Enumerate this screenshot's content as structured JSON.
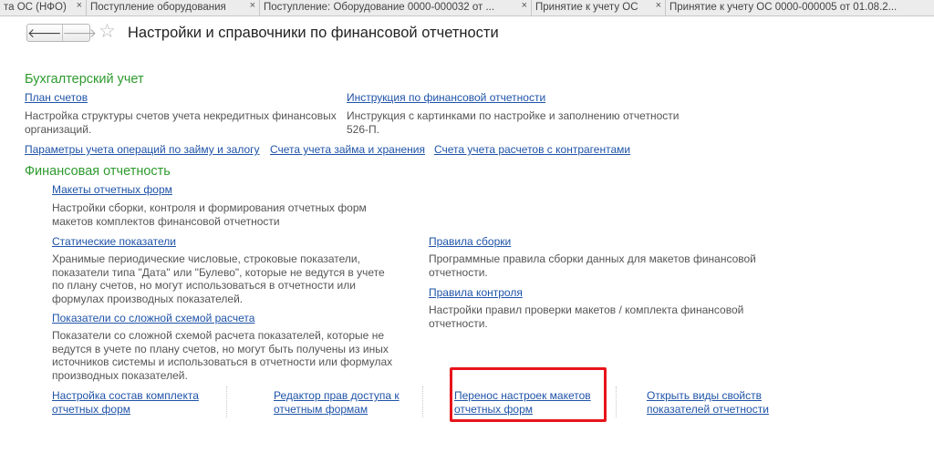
{
  "tabs": [
    {
      "label": "та ОС (НФО)"
    },
    {
      "label": "Поступление оборудования"
    },
    {
      "label": "Поступление: Оборудование 0000-000032 от ..."
    },
    {
      "label": "Принятие к учету ОС"
    },
    {
      "label": "Принятие к учету ОС 0000-000005 от 01.08.2..."
    }
  ],
  "header": {
    "back_icon": "arrow-left-icon",
    "forward_icon": "arrow-right-icon",
    "star_icon": "star-icon",
    "title": "Настройки и справочники по финансовой отчетности"
  },
  "accounting": {
    "heading": "Бухгалтерский учет",
    "chart_of_accounts": {
      "label": "План счетов",
      "desc_line1": "Настройка структуры счетов учета некредитных финансовых",
      "desc_line2": "организаций."
    },
    "instruction": {
      "label": "Инструкция по финансовой отчетности",
      "desc_line1": "Инструкция с картинками по настройке и заполнению отчетности",
      "desc_line2": "526-П."
    },
    "loan_params": "Параметры учета операций по займу и залогу",
    "loan_accounts": "Счета учета займа и хранения",
    "counterparty_accounts": "Счета учета расчетов с контрагентами"
  },
  "reporting": {
    "heading": "Финансовая отчетность",
    "templates": {
      "label": "Макеты отчетных форм",
      "desc_line1": "Настройки сборки, контроля и формирования отчетных форм",
      "desc_line2": "макетов комплектов финансовой отчетности"
    },
    "static_indicators": {
      "label": "Статические показатели",
      "desc_line1": "Хранимые периодические числовые, строковые показатели,",
      "desc_line2": "показатели типа \"Дата\" или \"Булево\", которые не ведутся в учете",
      "desc_line3": "по плану счетов, но могут использоваться в отчетности или",
      "desc_line4": "формулах производных показателей."
    },
    "assembly_rules": {
      "label": "Правила сборки",
      "desc_line1": "Программные правила сборки данных для макетов финансовой",
      "desc_line2": "отчетности."
    },
    "control_rules": {
      "label": "Правила контроля",
      "desc_line1": "Настройки правил проверки макетов / комплекта финансовой",
      "desc_line2": "отчетности."
    },
    "complex_indicators": {
      "label": "Показатели со сложной схемой расчета",
      "desc_line1": "Показатели со сложной схемой расчета показателей, которые не",
      "desc_line2": "ведутся в учете по плану счетов, но могут быть получены из иных",
      "desc_line3": "источников системы и использоваться в отчетности или формулах",
      "desc_line4": "производных показателей."
    },
    "bottom_links": [
      {
        "line1": "Настройка состав комплекта",
        "line2": "отчетных форм"
      },
      {
        "line1": "Редактор прав доступа к",
        "line2": "отчетным формам"
      },
      {
        "line1": "Перенос настроек макетов",
        "line2": "отчетных форм"
      },
      {
        "line1": "Открыть виды свойств",
        "line2": "показателей отчетности"
      }
    ]
  },
  "colors": {
    "link": "#1f53a8",
    "section_heading": "#2e9a2e",
    "highlight": "#e8141b"
  }
}
